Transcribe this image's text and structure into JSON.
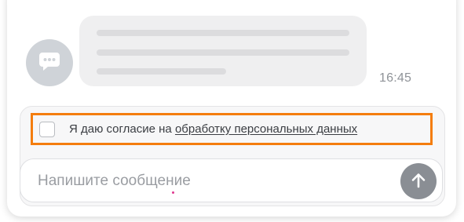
{
  "message": {
    "timestamp": "16:45",
    "avatar_icon": "chat-bubble-icon"
  },
  "consent": {
    "text": "Я даю согласие на ",
    "link_text": "обработку персональных данных",
    "checked": false,
    "highlight_color": "#f47d0e"
  },
  "composer": {
    "placeholder": "Напишите сообщение",
    "value": "",
    "send_icon": "arrow-up-icon"
  },
  "colors": {
    "bubble_bg": "#efeff0",
    "avatar_bg": "#cfd3d8",
    "send_button_bg": "#8a8e94"
  }
}
